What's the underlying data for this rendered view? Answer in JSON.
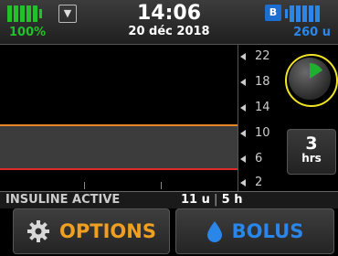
{
  "status": {
    "battery_percent": "100%",
    "battery_level": 1.0,
    "time": "14:06",
    "date": "20 déc 2018",
    "signal_icon": "signal-icon",
    "bluetooth_badge": "B",
    "reservoir_units": "260 u"
  },
  "graph": {
    "y_labels": [
      "22",
      "18",
      "14",
      "10",
      "6",
      "2"
    ],
    "target_high_color": "#e8862a",
    "target_low_color": "#e02a2a"
  },
  "controls": {
    "hours_value": "3",
    "hours_unit": "hrs"
  },
  "active_insulin": {
    "label": "INSULINE ACTIVE",
    "amount": "11 u",
    "duration": "5 h"
  },
  "buttons": {
    "options_label": "OPTIONS",
    "bolus_label": "BOLUS"
  }
}
